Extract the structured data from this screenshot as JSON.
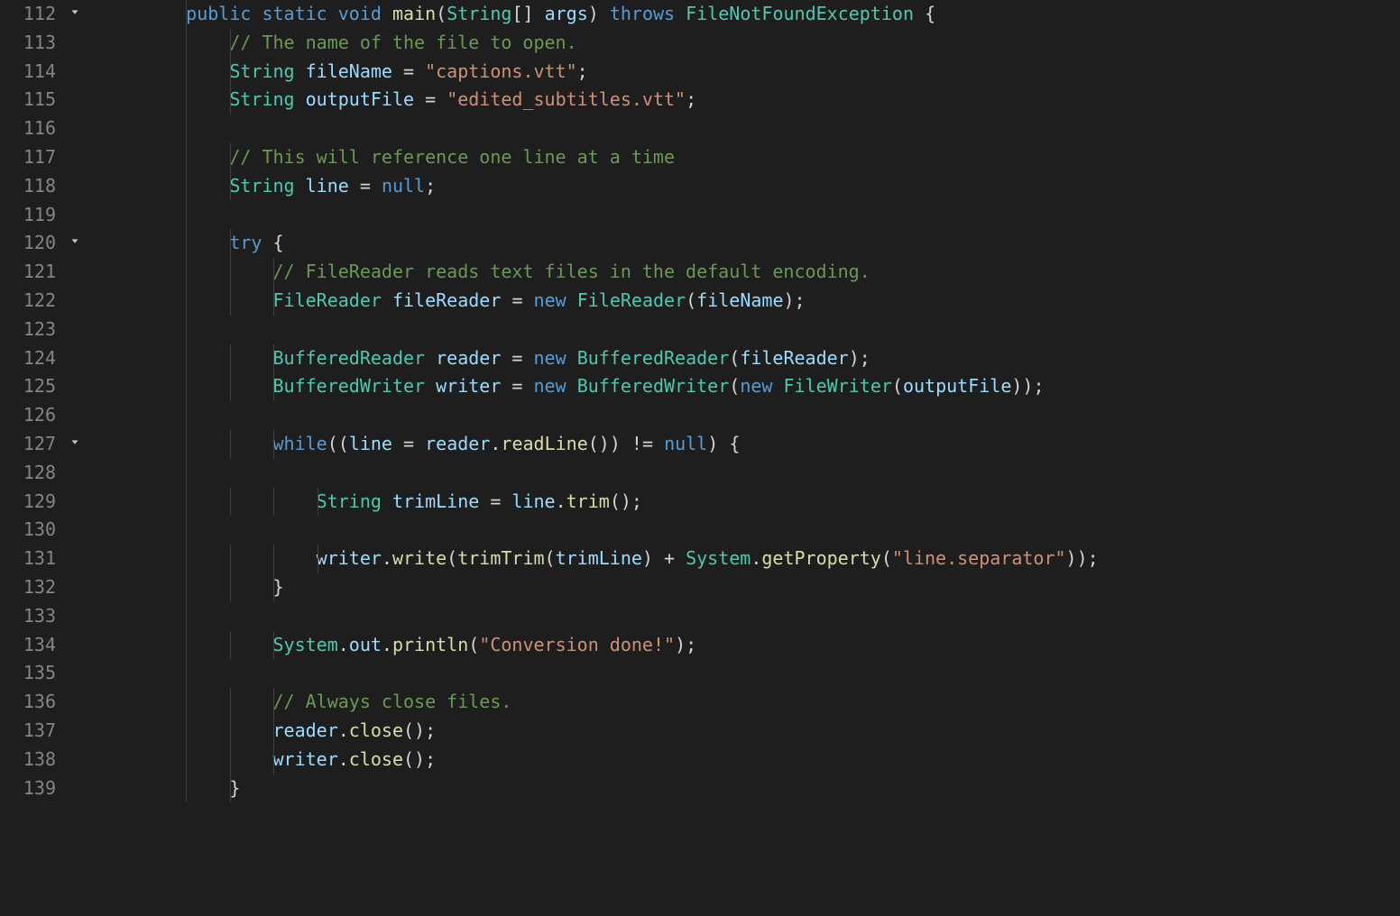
{
  "editor": {
    "startLine": 112,
    "foldLines": [
      112,
      120,
      127
    ],
    "lines": [
      {
        "n": 112,
        "indent": "    ",
        "tokens": [
          "kw:public",
          " ",
          "kw:static",
          " ",
          "kw:void",
          " ",
          "fn:main",
          "pun:(",
          "type:String",
          "pun:[] ",
          "id:args",
          "pun:) ",
          "kw:throws",
          " ",
          "type:FileNotFoundException",
          " ",
          "pun:{"
        ]
      },
      {
        "n": 113,
        "indent": "        ",
        "tokens": [
          "cmt:// The name of the file to open."
        ]
      },
      {
        "n": 114,
        "indent": "        ",
        "tokens": [
          "type:String",
          " ",
          "id:fileName",
          " ",
          "pun:=",
          " ",
          "str:\"captions.vtt\"",
          "pun:;"
        ]
      },
      {
        "n": 115,
        "indent": "        ",
        "tokens": [
          "type:String",
          " ",
          "id:outputFile",
          " ",
          "pun:=",
          " ",
          "str:\"edited_subtitles.vtt\"",
          "pun:;"
        ]
      },
      {
        "n": 116,
        "indent": "",
        "tokens": []
      },
      {
        "n": 117,
        "indent": "        ",
        "tokens": [
          "cmt:// This will reference one line at a time"
        ]
      },
      {
        "n": 118,
        "indent": "        ",
        "tokens": [
          "type:String",
          " ",
          "id:line",
          " ",
          "pun:=",
          " ",
          "kw:null",
          "pun:;"
        ]
      },
      {
        "n": 119,
        "indent": "",
        "tokens": []
      },
      {
        "n": 120,
        "indent": "        ",
        "tokens": [
          "kw:try",
          " ",
          "pun:{"
        ]
      },
      {
        "n": 121,
        "indent": "            ",
        "tokens": [
          "cmt:// FileReader reads text files in the default encoding."
        ]
      },
      {
        "n": 122,
        "indent": "            ",
        "tokens": [
          "type:FileReader",
          " ",
          "id:fileReader",
          " ",
          "pun:=",
          " ",
          "kw:new",
          " ",
          "type:FileReader",
          "pun:(",
          "id:fileName",
          "pun:);"
        ]
      },
      {
        "n": 123,
        "indent": "",
        "tokens": []
      },
      {
        "n": 124,
        "indent": "            ",
        "tokens": [
          "type:BufferedReader",
          " ",
          "id:reader",
          " ",
          "pun:=",
          " ",
          "kw:new",
          " ",
          "type:BufferedReader",
          "pun:(",
          "id:fileReader",
          "pun:);"
        ]
      },
      {
        "n": 125,
        "indent": "            ",
        "tokens": [
          "type:BufferedWriter",
          " ",
          "id:writer",
          " ",
          "pun:=",
          " ",
          "kw:new",
          " ",
          "type:BufferedWriter",
          "pun:(",
          "kw:new",
          " ",
          "type:FileWriter",
          "pun:(",
          "id:outputFile",
          "pun:));"
        ]
      },
      {
        "n": 126,
        "indent": "",
        "tokens": []
      },
      {
        "n": 127,
        "indent": "            ",
        "tokens": [
          "kw:while",
          "pun:((",
          "id:line",
          " ",
          "pun:=",
          " ",
          "id:reader",
          "pun:.",
          "fn:readLine",
          "pun:()) ",
          "pun:!=",
          " ",
          "kw:null",
          "pun:) {"
        ]
      },
      {
        "n": 128,
        "indent": "",
        "tokens": []
      },
      {
        "n": 129,
        "indent": "                ",
        "tokens": [
          "type:String",
          " ",
          "id:trimLine",
          " ",
          "pun:=",
          " ",
          "id:line",
          "pun:.",
          "fn:trim",
          "pun:();"
        ]
      },
      {
        "n": 130,
        "indent": "",
        "tokens": []
      },
      {
        "n": 131,
        "indent": "                ",
        "tokens": [
          "id:writer",
          "pun:.",
          "fn:write",
          "pun:(",
          "fn:trimTrim",
          "pun:(",
          "id:trimLine",
          "pun:) + ",
          "type:System",
          "pun:.",
          "fn:getProperty",
          "pun:(",
          "str:\"line.separator\"",
          "pun:));"
        ]
      },
      {
        "n": 132,
        "indent": "            ",
        "tokens": [
          "pun:}"
        ]
      },
      {
        "n": 133,
        "indent": "",
        "tokens": []
      },
      {
        "n": 134,
        "indent": "            ",
        "tokens": [
          "type:System",
          "pun:.",
          "id:out",
          "pun:.",
          "fn:println",
          "pun:(",
          "str:\"Conversion done!\"",
          "pun:);"
        ]
      },
      {
        "n": 135,
        "indent": "",
        "tokens": []
      },
      {
        "n": 136,
        "indent": "            ",
        "tokens": [
          "cmt:// Always close files."
        ]
      },
      {
        "n": 137,
        "indent": "            ",
        "tokens": [
          "id:reader",
          "pun:.",
          "fn:close",
          "pun:();"
        ]
      },
      {
        "n": 138,
        "indent": "            ",
        "tokens": [
          "id:writer",
          "pun:.",
          "fn:close",
          "pun:();"
        ]
      },
      {
        "n": 139,
        "indent": "        ",
        "tokens": [
          "pun:}"
        ]
      }
    ],
    "baseIndentOffset": 50,
    "indentUnit": 12.1,
    "colors": {
      "keyword": "#569cd6",
      "type": "#4ec9b0",
      "function": "#dcdcaa",
      "identifier": "#9cdcfe",
      "string": "#ce9178",
      "comment": "#6a9955",
      "punctuation": "#d4d4d4"
    }
  }
}
